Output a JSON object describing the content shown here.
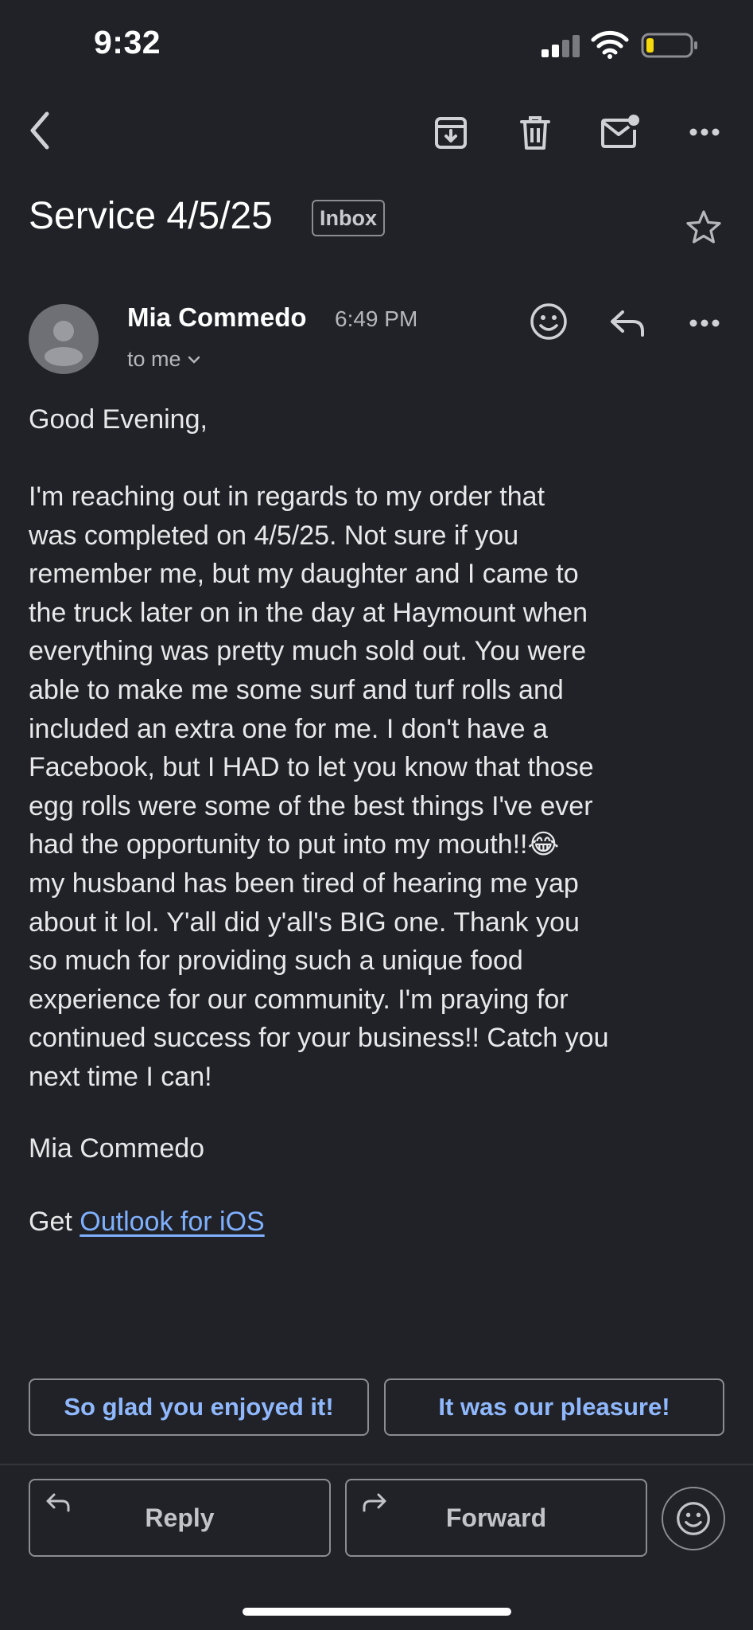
{
  "status_bar": {
    "time": "9:32"
  },
  "email": {
    "subject": "Service 4/5/25",
    "label": "Inbox",
    "sender": "Mia Commedo",
    "time": "6:49 PM",
    "recipient": "to me",
    "greeting": "Good Evening,",
    "body": "    I'm reaching out in regards to my order that\nwas completed on 4/5/25. Not sure if you\nremember me, but my daughter and I came to\nthe truck later on in the day at Haymount when\neverything was pretty much sold out. You were\nable to make me some surf and turf rolls and\nincluded an extra one for me. I don't have a\nFacebook, but I HAD to let you know that those\negg rolls were some of the best things I've ever\nhad the opportunity to put into my mouth!!😂\nmy husband has been tired of hearing me yap\nabout it lol. Y'all did y'all's BIG one. Thank you\nso much for providing such a unique food\nexperience for our community. I'm praying for\ncontinued success for your business!! Catch you\nnext time I can!",
    "signature": "Mia Commedo",
    "footer_prefix": "Get",
    "footer_link": "Outlook for iOS"
  },
  "smart_replies": [
    "So glad you enjoyed it!",
    "It was our pleasure!"
  ],
  "actions": {
    "reply": "Reply",
    "forward": "Forward"
  },
  "colors": {
    "background": "#212227",
    "link": "#7fb0ff",
    "chip_text": "#8fb8ff",
    "battery_low": "#f5d90a"
  },
  "icons": {
    "back": "chevron-left-icon",
    "archive": "archive-icon",
    "delete": "trash-icon",
    "unread": "mark-unread-icon",
    "more": "more-horizontal-icon",
    "star": "star-icon",
    "emoji": "smiley-icon",
    "reply": "reply-icon",
    "forward": "forward-icon"
  }
}
